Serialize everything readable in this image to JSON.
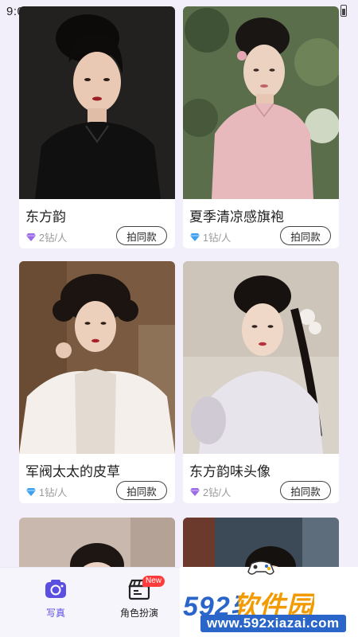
{
  "status_bar": {
    "time": "9:0"
  },
  "cards": [
    {
      "title": "东方韵",
      "price": "2钻/人",
      "gem": "gem-purple",
      "button": "拍同款"
    },
    {
      "title": "夏季清凉感旗袍",
      "price": "1钻/人",
      "gem": "gem-blue",
      "button": "拍同款"
    },
    {
      "title": "军阀太太的皮草",
      "price": "1钻/人",
      "gem": "gem-blue",
      "button": "拍同款"
    },
    {
      "title": "东方韵味头像",
      "price": "2钻/人",
      "gem": "gem-purple",
      "button": "拍同款"
    }
  ],
  "tabbar": {
    "tabs": [
      {
        "label": "写真",
        "icon": "camera-icon",
        "active": true
      },
      {
        "label": "角色扮演",
        "icon": "clapperboard-icon",
        "active": false,
        "badge": "New"
      }
    ]
  },
  "watermark": {
    "brand": "592软件园",
    "url": "www.592xiazai.com"
  },
  "colors": {
    "accent": "#5b4fe0",
    "background": "#f2effa",
    "gem_blue": "#3ea0f0",
    "gem_purple": "#9b6be8",
    "badge": "#ff3b3b"
  }
}
